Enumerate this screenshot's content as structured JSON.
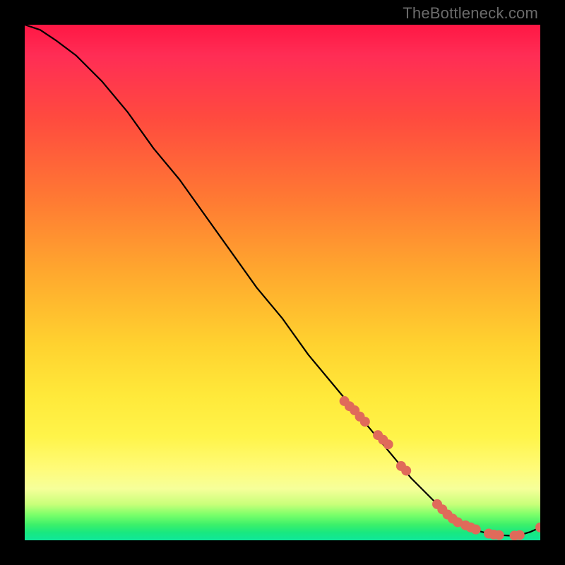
{
  "watermark": "TheBottleneck.com",
  "colors": {
    "gradient_top": "#ff1744",
    "gradient_mid": "#ffd22f",
    "gradient_bottom": "#10e79a",
    "frame": "#000000",
    "curve": "#000000",
    "markers": "#e06a5a"
  },
  "chart_data": {
    "type": "line",
    "title": "",
    "xlabel": "",
    "ylabel": "",
    "xlim": [
      0,
      100
    ],
    "ylim": [
      0,
      100
    ],
    "series": [
      {
        "name": "bottleneck-curve",
        "x": [
          0,
          3,
          6,
          10,
          15,
          20,
          25,
          30,
          35,
          40,
          45,
          50,
          55,
          60,
          65,
          70,
          75,
          80,
          82,
          84,
          86,
          88,
          90,
          92,
          94,
          96,
          98,
          100
        ],
        "y": [
          100,
          99,
          97,
          94,
          89,
          83,
          76,
          70,
          63,
          56,
          49,
          43,
          36,
          30,
          24,
          18,
          12,
          7,
          5,
          3.5,
          2.5,
          1.8,
          1.3,
          1.0,
          0.9,
          1.0,
          1.6,
          2.5
        ]
      }
    ],
    "highlighted_points": {
      "name": "markers",
      "x": [
        62,
        63,
        64,
        65,
        66,
        68.5,
        69.5,
        70.5,
        73,
        74,
        80,
        81,
        82,
        83,
        84,
        85.5,
        86.5,
        87.5,
        90,
        91,
        92,
        95,
        96,
        100
      ],
      "y": [
        27,
        26,
        25.2,
        24,
        23,
        20.4,
        19.5,
        18.6,
        14.4,
        13.5,
        7.0,
        6.0,
        5.0,
        4.2,
        3.5,
        2.9,
        2.5,
        2.1,
        1.3,
        1.1,
        1.0,
        0.9,
        1.0,
        2.5
      ]
    }
  }
}
